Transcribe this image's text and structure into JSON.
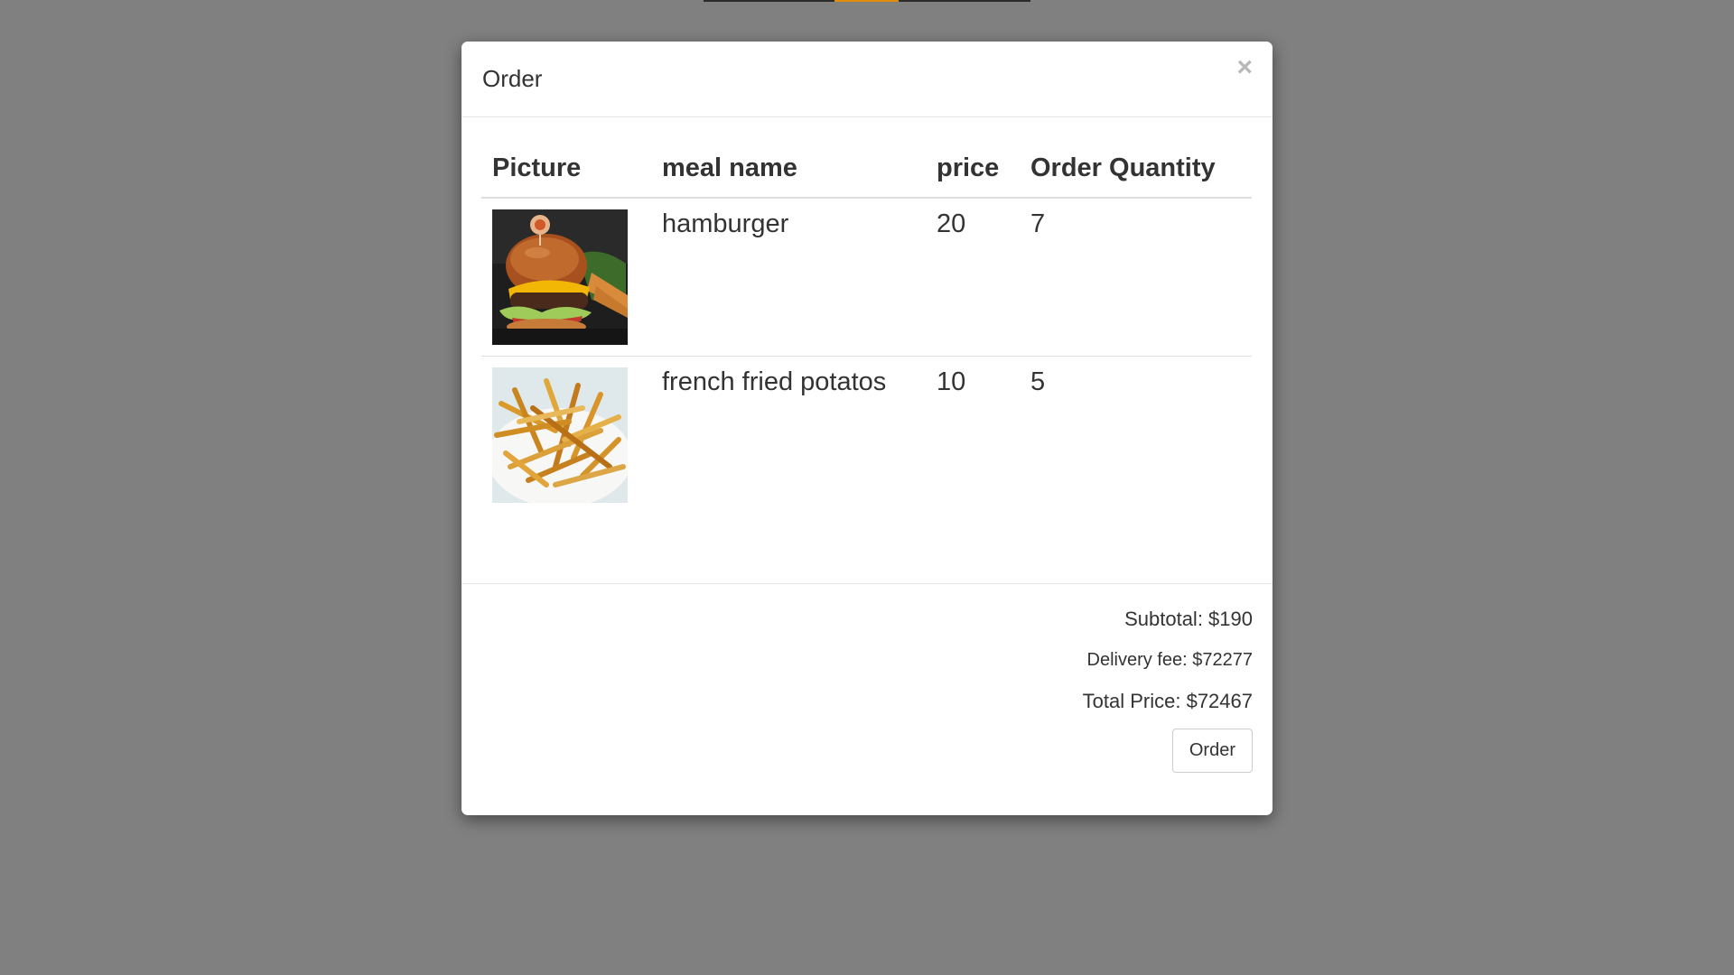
{
  "modal": {
    "title": "Order",
    "close_label": "×"
  },
  "table": {
    "headers": [
      "Picture",
      "meal name",
      "price",
      "Order Quantity"
    ],
    "rows": [
      {
        "image": "hamburger-photo",
        "meal_name": "hamburger",
        "price": "20",
        "quantity": "7"
      },
      {
        "image": "french-fries-photo",
        "meal_name": "french fried potatos",
        "price": "10",
        "quantity": "5"
      }
    ]
  },
  "summary": {
    "subtotal": "Subtotal: $190",
    "delivery_fee": "Delivery fee: $72277",
    "total_price": "Total Price: $72467"
  },
  "footer": {
    "order_button_label": "Order"
  },
  "colors": {
    "backdrop": "#808080",
    "nav_accent": "#e08e0b"
  }
}
